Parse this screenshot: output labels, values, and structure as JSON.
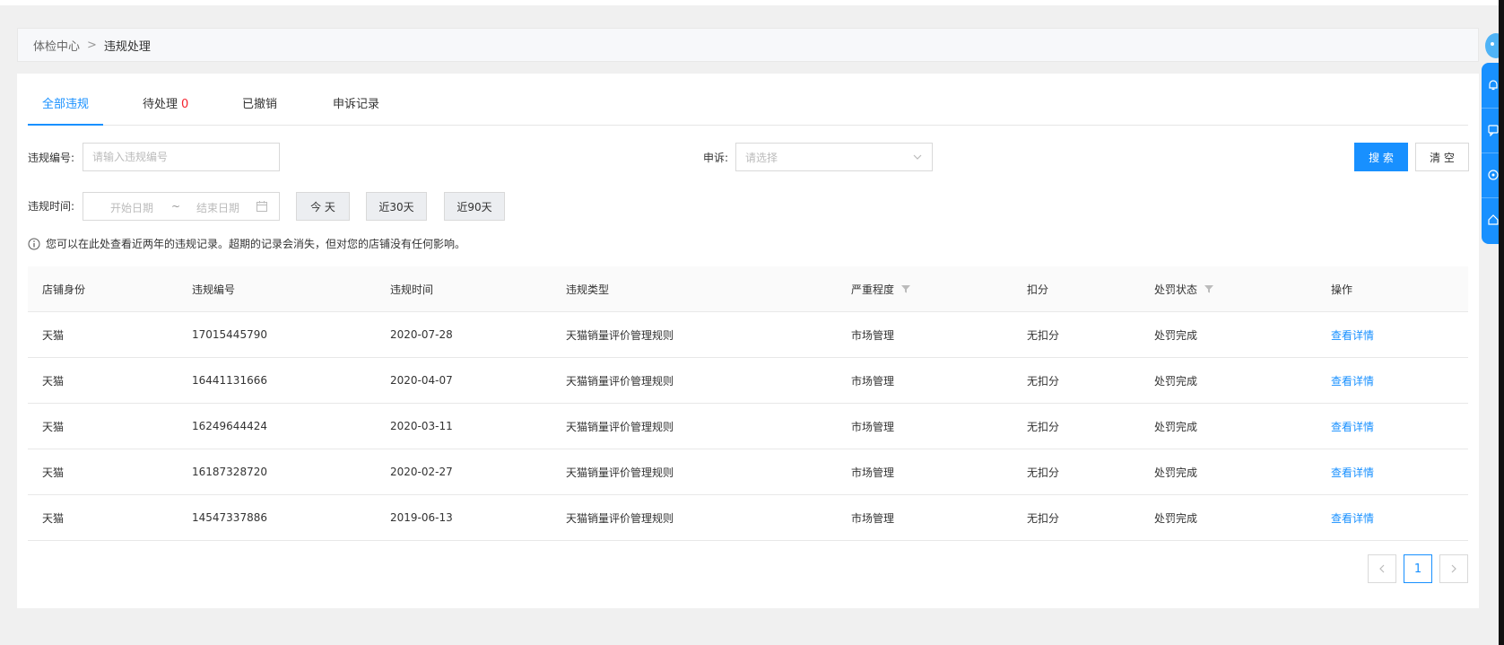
{
  "breadcrumb": {
    "parent": "体检中心",
    "separator": ">",
    "current": "违规处理"
  },
  "tabs": [
    {
      "label": "全部违规",
      "active": true
    },
    {
      "label": "待处理",
      "count": "0"
    },
    {
      "label": "已撤销"
    },
    {
      "label": "申诉记录"
    }
  ],
  "filters": {
    "violation_no_label": "违规编号:",
    "violation_no_placeholder": "请输入违规编号",
    "appeal_label": "申诉:",
    "appeal_placeholder": "请选择",
    "time_label": "违规时间:",
    "start_date_placeholder": "开始日期",
    "range_separator": "~",
    "end_date_placeholder": "结束日期",
    "quick_ranges": [
      "今 天",
      "近30天",
      "近90天"
    ],
    "search_button": "搜 索",
    "clear_button": "清 空"
  },
  "notice": "您可以在此处查看近两年的违规记录。超期的记录会消失，但对您的店铺没有任何影响。",
  "table": {
    "columns": [
      "店铺身份",
      "违规编号",
      "违规时间",
      "违规类型",
      "严重程度",
      "扣分",
      "处罚状态",
      "操作"
    ],
    "rows": [
      [
        "天猫",
        "17015445790",
        "2020-07-28",
        "天猫销量评价管理规则",
        "市场管理",
        "无扣分",
        "处罚完成",
        "查看详情"
      ],
      [
        "天猫",
        "16441131666",
        "2020-04-07",
        "天猫销量评价管理规则",
        "市场管理",
        "无扣分",
        "处罚完成",
        "查看详情"
      ],
      [
        "天猫",
        "16249644424",
        "2020-03-11",
        "天猫销量评价管理规则",
        "市场管理",
        "无扣分",
        "处罚完成",
        "查看详情"
      ],
      [
        "天猫",
        "16187328720",
        "2020-02-27",
        "天猫销量评价管理规则",
        "市场管理",
        "无扣分",
        "处罚完成",
        "查看详情"
      ],
      [
        "天猫",
        "14547337886",
        "2019-06-13",
        "天猫销量评价管理规则",
        "市场管理",
        "无扣分",
        "处罚完成",
        "查看详情"
      ]
    ]
  },
  "pagination": {
    "current": "1",
    "prev_icon": "chevron-left-icon",
    "next_icon": "chevron-right-icon"
  },
  "colors": {
    "accent": "#1890ff",
    "count_red": "#f5222d"
  }
}
